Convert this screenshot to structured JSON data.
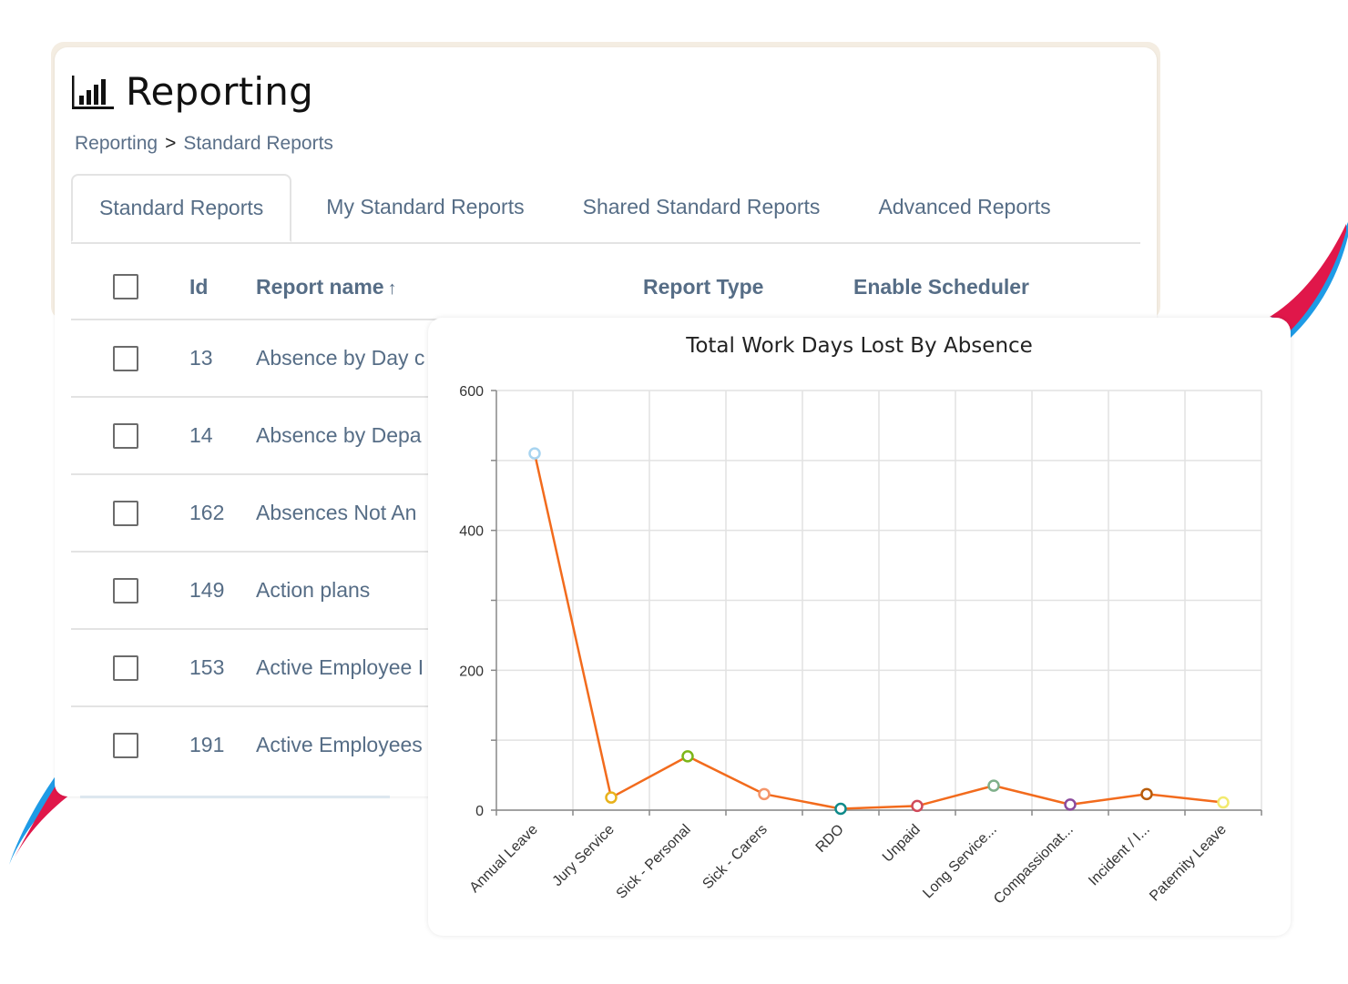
{
  "header": {
    "icon": "bar-chart-icon",
    "title": "Reporting"
  },
  "breadcrumb": {
    "items": [
      "Reporting",
      "Standard Reports"
    ],
    "separator": ">"
  },
  "tabs": [
    {
      "label": "Standard Reports",
      "active": true
    },
    {
      "label": "My Standard Reports",
      "active": false
    },
    {
      "label": "Shared Standard Reports",
      "active": false
    },
    {
      "label": "Advanced Reports",
      "active": false
    }
  ],
  "table": {
    "columns": {
      "id": "Id",
      "name": "Report name",
      "name_sort": "↑",
      "type": "Report Type",
      "scheduler": "Enable Scheduler"
    },
    "rows": [
      {
        "id": "13",
        "name": "Absence by Day c",
        "checked": false
      },
      {
        "id": "14",
        "name": "Absence by Depa",
        "checked": false
      },
      {
        "id": "162",
        "name": "Absences Not An",
        "checked": false
      },
      {
        "id": "149",
        "name": "Action plans",
        "checked": false
      },
      {
        "id": "153",
        "name": "Active Employee I",
        "checked": false
      },
      {
        "id": "191",
        "name": "Active Employees",
        "checked": false
      }
    ]
  },
  "colors": {
    "line": "#f26b1d",
    "text_muted": "#566d86",
    "swoosh_red": "#e0174a",
    "swoosh_blue": "#1e9be6"
  },
  "chart_data": {
    "type": "line",
    "title": "Total Work Days Lost By Absence",
    "xlabel": "",
    "ylabel": "",
    "ylim": [
      0,
      600
    ],
    "yticks": [
      0,
      200,
      400,
      600
    ],
    "yminor": [
      100,
      300,
      500
    ],
    "grid": true,
    "legend": "none",
    "categories": [
      "Annual Leave",
      "Jury Service",
      "Sick - Personal",
      "Sick - Carers",
      "RDO",
      "Unpaid",
      "Long Service...",
      "Compassionat...",
      "Incident / I...",
      "Paternity Leave"
    ],
    "series": [
      {
        "name": "Total Work Days Lost",
        "values": [
          510,
          18,
          77,
          23,
          2,
          6,
          35,
          8,
          23,
          11
        ],
        "point_colors": [
          "#a8d4f0",
          "#e8b21c",
          "#7cb518",
          "#f4956a",
          "#0f8a8a",
          "#d04a5a",
          "#7fb08a",
          "#8c4b9c",
          "#b85c0a",
          "#f2ea6e"
        ]
      }
    ]
  }
}
